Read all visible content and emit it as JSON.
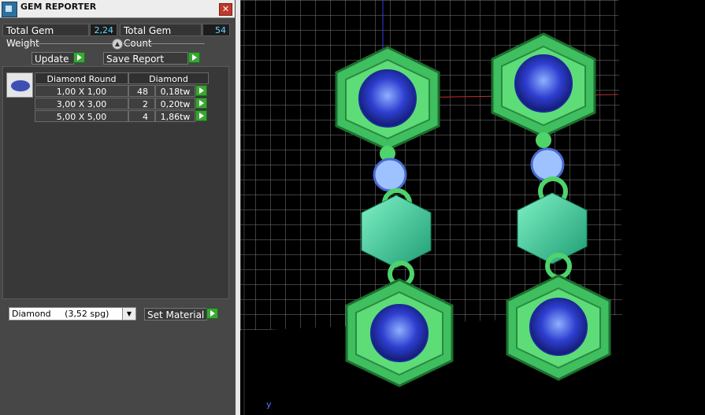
{
  "window": {
    "title": "GEM REPORTER",
    "close_glyph": "✕"
  },
  "totals": {
    "weight_label": "Total Gem Weight",
    "weight_value": "2,24",
    "count_label": "Total Gem Count",
    "count_value": "54"
  },
  "toolbar": {
    "update_label": "Update",
    "save_label": "Save Report"
  },
  "table": {
    "headers": [
      "Diamond Round",
      "Diamond"
    ],
    "rows": [
      {
        "size": "1,00 X 1,00",
        "count": "48",
        "weight": "0,18tw"
      },
      {
        "size": "3,00 X 3,00",
        "count": "2",
        "weight": "0,20tw"
      },
      {
        "size": "5,00 X 5,00",
        "count": "4",
        "weight": "1,86tw"
      }
    ]
  },
  "material": {
    "select_value": "Diamond     (3,52 spg)",
    "button_label": "Set Material"
  },
  "viewport": {
    "axis_label": "y"
  },
  "colors": {
    "panel": "#474747",
    "value_text": "#64d7ff",
    "accent_green": "#3aa635",
    "metal": "#4fd36b",
    "stone": "#2e3fd0"
  }
}
